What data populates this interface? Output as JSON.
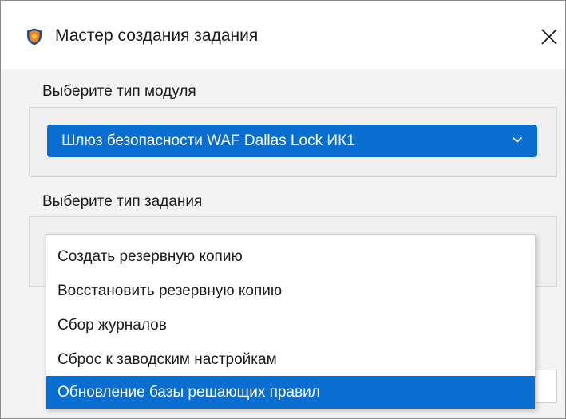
{
  "window": {
    "title": "Мастер создания задания"
  },
  "module_section": {
    "label": "Выберите тип модуля",
    "selected_value": "Шлюз безопасности WAF Dallas Lock ИК1"
  },
  "task_section": {
    "label": "Выберите тип задания",
    "options": [
      {
        "label": "Создать резервную копию"
      },
      {
        "label": "Восстановить резервную копию"
      },
      {
        "label": "Сбор журналов"
      },
      {
        "label": "Сброс к заводским настройкам"
      },
      {
        "label": "Обновление базы решающих правил",
        "selected": true
      }
    ]
  },
  "colors": {
    "accent": "#0a6ed1",
    "window_bg": "#f3f3f3",
    "text": "#1a1a1a"
  },
  "icons": {
    "app": "shield-icon",
    "close": "close-icon",
    "dropdown": "chevron-down-icon"
  }
}
